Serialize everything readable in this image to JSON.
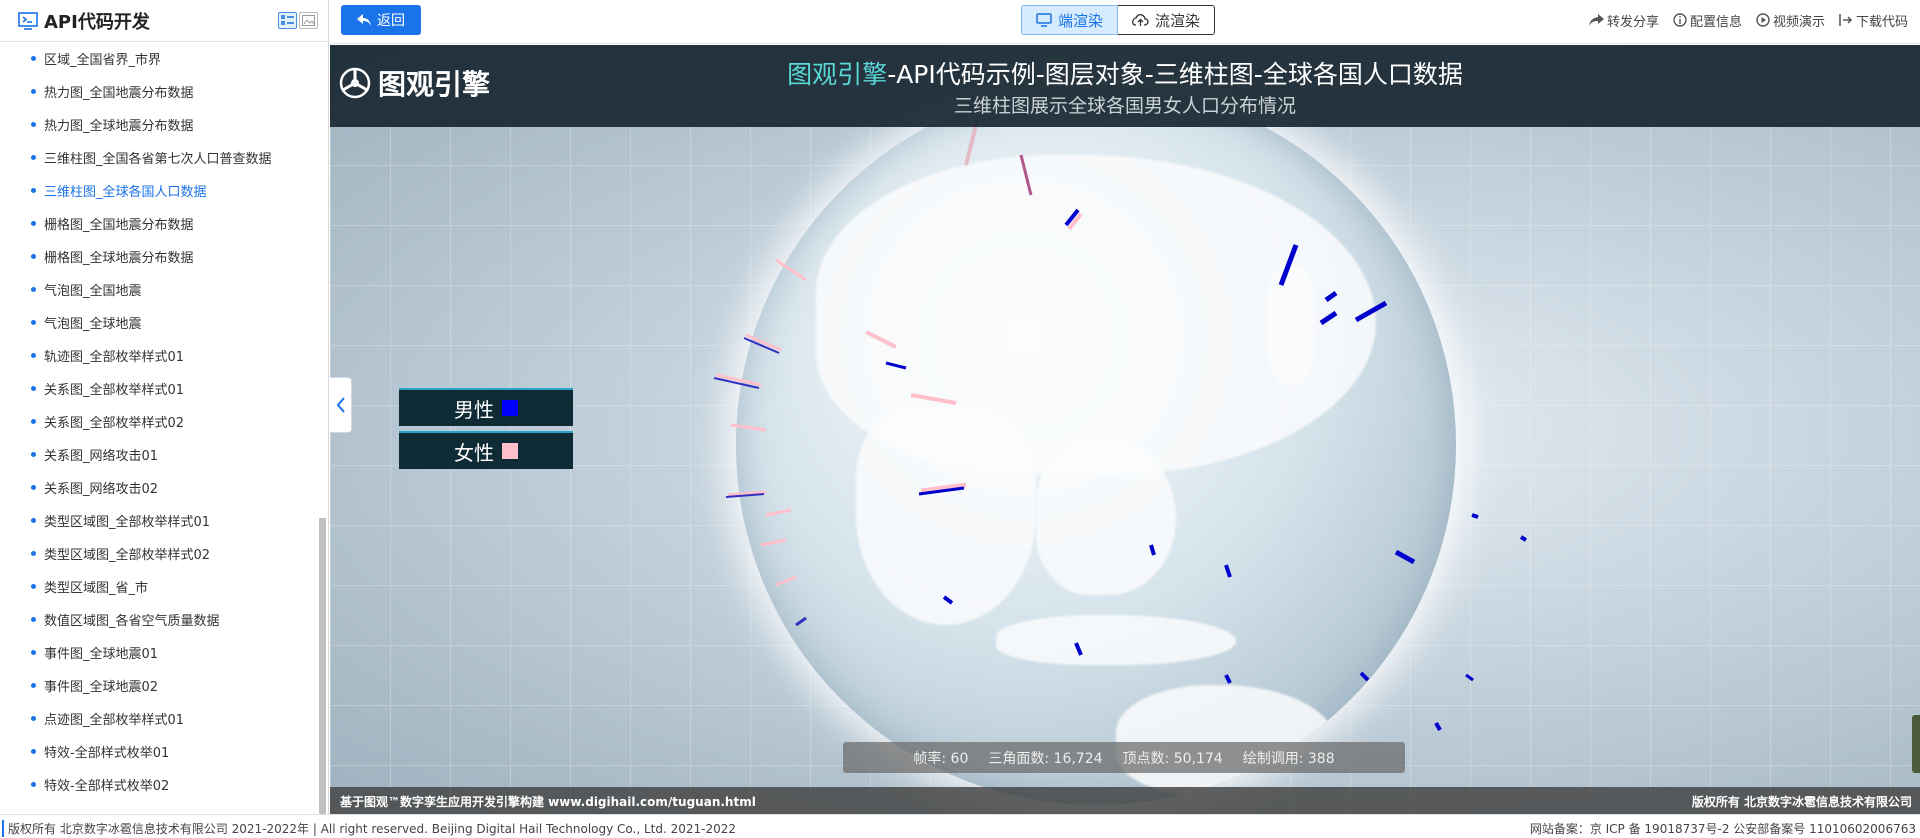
{
  "sidebar": {
    "title": "API代码开发",
    "items": [
      {
        "label": "区域_全国省界_市界",
        "active": false
      },
      {
        "label": "热力图_全国地震分布数据",
        "active": false
      },
      {
        "label": "热力图_全球地震分布数据",
        "active": false
      },
      {
        "label": "三维柱图_全国各省第七次人口普查数据",
        "active": false
      },
      {
        "label": "三维柱图_全球各国人口数据",
        "active": true
      },
      {
        "label": "栅格图_全国地震分布数据",
        "active": false
      },
      {
        "label": "栅格图_全球地震分布数据",
        "active": false
      },
      {
        "label": "气泡图_全国地震",
        "active": false
      },
      {
        "label": "气泡图_全球地震",
        "active": false
      },
      {
        "label": "轨迹图_全部枚举样式01",
        "active": false
      },
      {
        "label": "关系图_全部枚举样式01",
        "active": false
      },
      {
        "label": "关系图_全部枚举样式02",
        "active": false
      },
      {
        "label": "关系图_网络攻击01",
        "active": false
      },
      {
        "label": "关系图_网络攻击02",
        "active": false
      },
      {
        "label": "类型区域图_全部枚举样式01",
        "active": false
      },
      {
        "label": "类型区域图_全部枚举样式02",
        "active": false
      },
      {
        "label": "类型区域图_省_市",
        "active": false
      },
      {
        "label": "数值区域图_各省空气质量数据",
        "active": false
      },
      {
        "label": "事件图_全球地震01",
        "active": false
      },
      {
        "label": "事件图_全球地震02",
        "active": false
      },
      {
        "label": "点迹图_全部枚举样式01",
        "active": false
      },
      {
        "label": "特效-全部样式枚举01",
        "active": false
      },
      {
        "label": "特效-全部样式枚举02",
        "active": false
      }
    ]
  },
  "toolbar": {
    "back_label": "返回",
    "render_client": "端渲染",
    "render_stream": "流渲染",
    "actions": [
      "转发分享",
      "配置信息",
      "视频演示",
      "下载代码"
    ]
  },
  "scene": {
    "brand": "图观引擎",
    "title_highlight": "图观引擎",
    "title_rest": "-API代码示例-图层对象-三维柱图-全球各国人口数据",
    "subtitle": "三维柱图展示全球各国男女人口分布情况",
    "legend": [
      {
        "label": "男性",
        "color": "#0000ff"
      },
      {
        "label": "女性",
        "color": "#ffc0cb"
      }
    ],
    "stats": {
      "fps_label": "帧率:",
      "fps": "60",
      "tri_label": "三角面数:",
      "tri": "16,724",
      "vert_label": "顶点数:",
      "vert": "50,174",
      "draw_label": "绘制调用:",
      "draw": "388"
    },
    "footer_left": "基于图观™数字孪生应用开发引擎构建 www.digihail.com/tuguan.html",
    "footer_right": "版权所有 北京数字冰雹信息技术有限公司"
  },
  "status": {
    "left": "版权所有 北京数字冰雹信息技术有限公司 2021-2022年 | All right reserved. Beijing Digital Hail Technology Co., Ltd. 2021-2022",
    "right": "网站备案：京 ICP 备 19018737号-2 公安部备案号 11010602006763"
  },
  "colors": {
    "accent": "#1a73e8",
    "title_highlight": "#5ad8d8",
    "male": "#0000ff",
    "female": "#ffc0cb"
  }
}
